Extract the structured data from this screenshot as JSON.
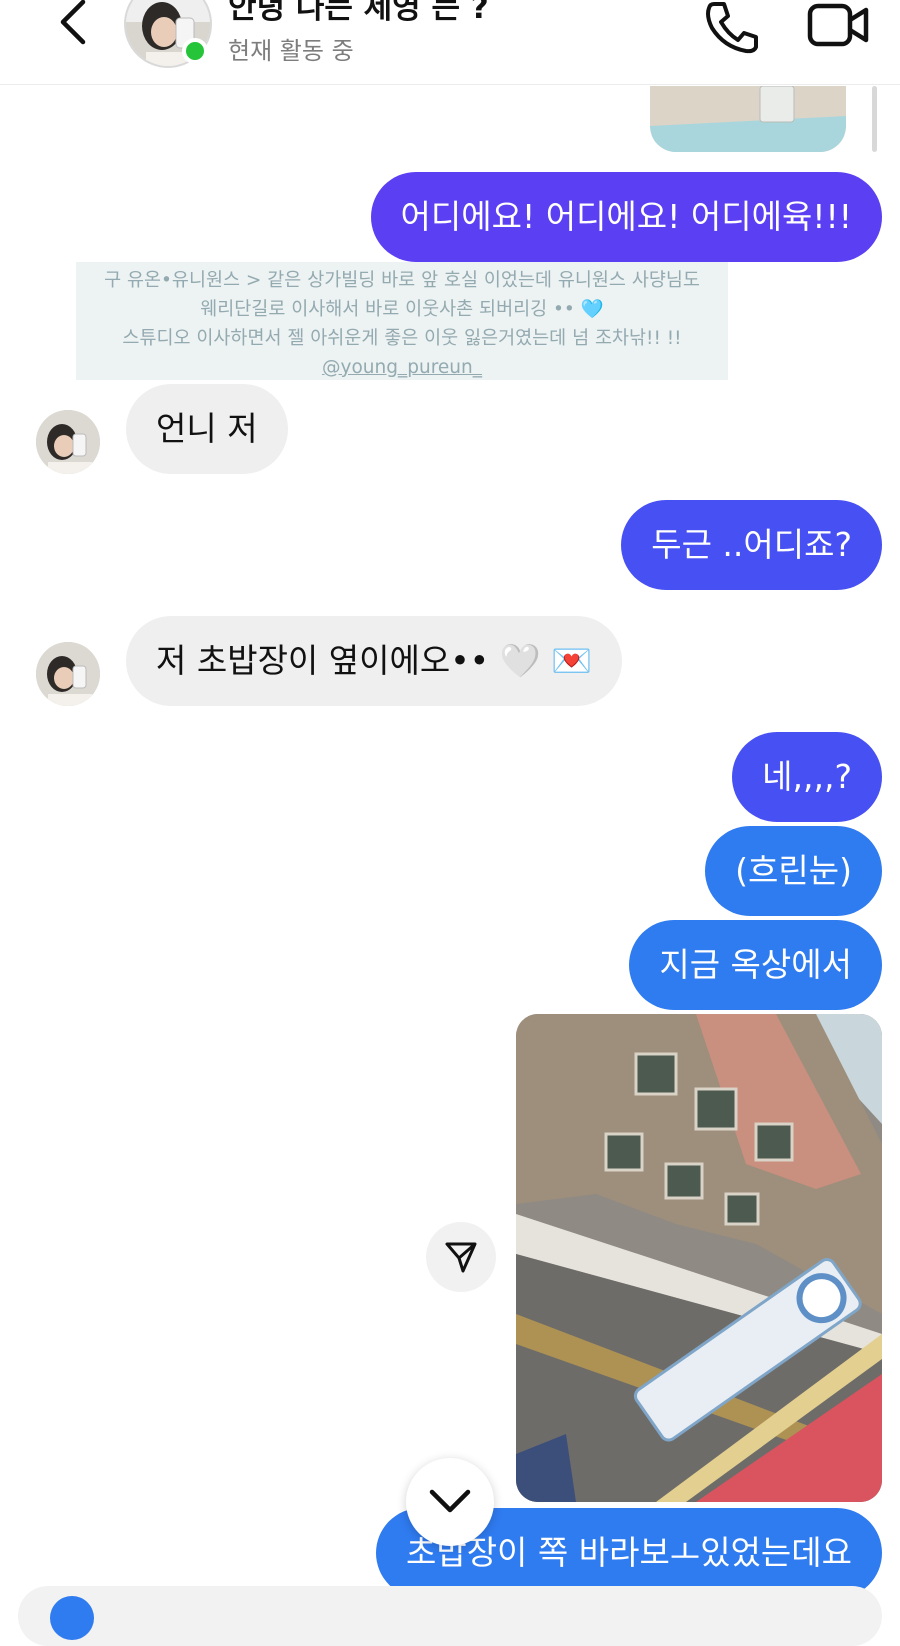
{
  "header": {
    "name": "안녕 나는 세영 는 ?",
    "status": "현재 활동 중",
    "icons": {
      "back": "chevron-left-icon",
      "call": "phone-icon",
      "video": "video-camera-icon"
    }
  },
  "colors": {
    "sent_purple": "#5b3ff2",
    "sent_indigo": "#4750f2",
    "sent_blue": "#2f7bf0",
    "received": "#efefef",
    "online": "#26c439"
  },
  "messages": [
    {
      "type": "sent",
      "text": "어디에요! 어디에요! 어디에육!!!"
    },
    {
      "type": "shared_caption",
      "lines": [
        "구 유온•유니원스 > 같은 상가빌딩 바로 앞 호실 이었는데 유니원스 사댱님도",
        "웨리단길로 이사해서 바로 이웃사촌 되버리깅 •• 🩵",
        "스튜디오 이사하면서 젤 아쉬운게 좋은 이웃 잃은거였는데 넘 조차낚!! !!"
      ],
      "handle": "@young_pureun_"
    },
    {
      "type": "received",
      "text": "언니 저"
    },
    {
      "type": "sent",
      "text": "두근 ..어디죠?"
    },
    {
      "type": "received",
      "text": "저 초밥장이 옆이에오•• 🤍 💌"
    },
    {
      "type": "sent",
      "text": "네,,,,?"
    },
    {
      "type": "sent",
      "text": "(흐린눈)"
    },
    {
      "type": "sent",
      "text": "지금 옥상에서"
    },
    {
      "type": "sent_photo",
      "description_icon": "photo-street-icon"
    },
    {
      "type": "sent",
      "text": "초밥장이 쪽 바라보ㅗ있었는데요"
    }
  ]
}
